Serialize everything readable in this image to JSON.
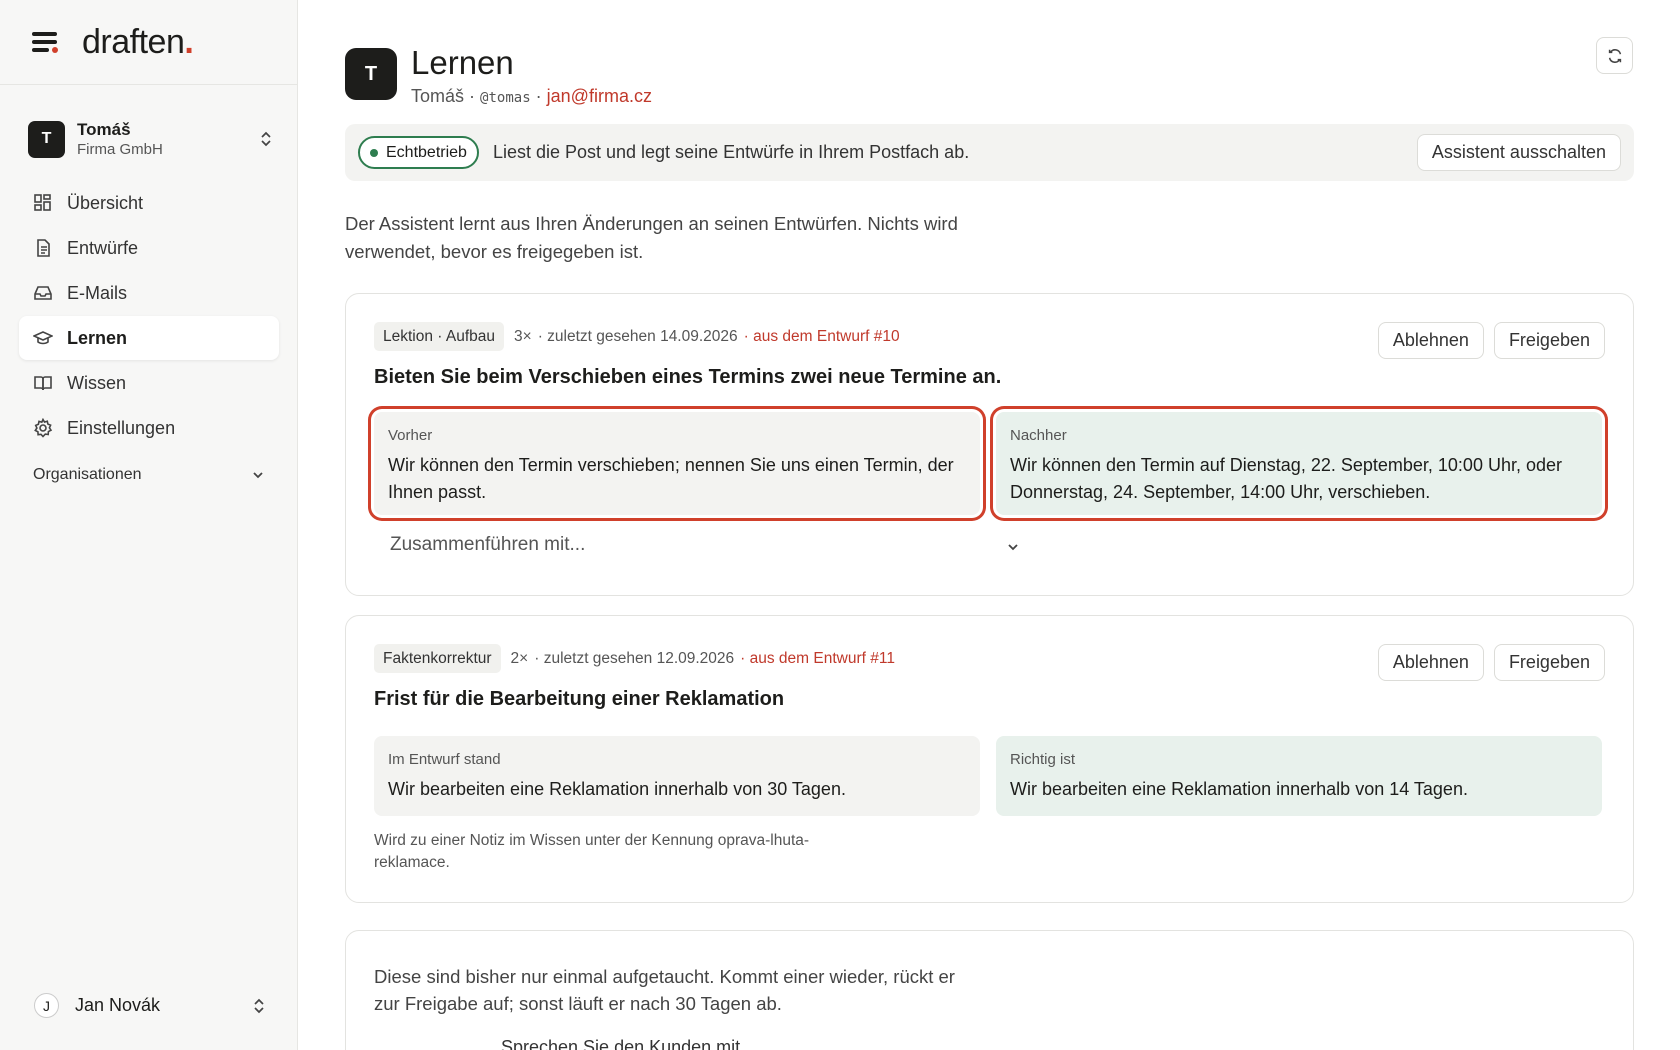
{
  "sidebar": {
    "logo": "draften",
    "logo_dot": ".",
    "org": {
      "avatar": "T",
      "name": "Tomáš",
      "company": "Firma GmbH"
    },
    "nav": [
      {
        "label": "Übersicht",
        "icon": "grid-icon"
      },
      {
        "label": "Entwürfe",
        "icon": "document-icon"
      },
      {
        "label": "E-Mails",
        "icon": "inbox-icon"
      },
      {
        "label": "Lernen",
        "icon": "graduation-cap-icon",
        "active": true
      },
      {
        "label": "Wissen",
        "icon": "book-icon"
      },
      {
        "label": "Einstellungen",
        "icon": "gear-icon"
      }
    ],
    "organisations_label": "Organisationen",
    "user": {
      "avatar": "J",
      "name": "Jan Novák"
    }
  },
  "header": {
    "avatar": "T",
    "title": "Lernen",
    "name": "Tomáš",
    "handle": "@tomas",
    "email": "jan@firma.cz",
    "sep": "·"
  },
  "banner": {
    "status": "Echtbetrieb",
    "text": "Liest die Post und legt seine Entwürfe in Ihrem Postfach ab.",
    "button": "Assistent ausschalten"
  },
  "intro": "Der Assistent lernt aus Ihren Änderungen an seinen Entwürfen. Nichts wird verwendet, bevor es freigegeben ist.",
  "lessons": [
    {
      "tag": "Lektion · Aufbau",
      "count": "3×",
      "last_seen": "· zuletzt gesehen 14.09.2026",
      "source": "· aus dem Entwurf #10",
      "reject": "Ablehnen",
      "approve": "Freigeben",
      "title": "Bieten Sie beim Verschieben eines Termins zwei neue Termine an.",
      "before_label": "Vorher",
      "before_text": "Wir können den Termin verschieben; nennen Sie uns einen Termin, der Ihnen passt.",
      "after_label": "Nachher",
      "after_text": "Wir können den Termin auf Dienstag, 22. September, 10:00 Uhr, oder Donnerstag, 24. September, 14:00 Uhr, verschieben.",
      "merge_placeholder": "Zusammenführen mit..."
    },
    {
      "tag": "Faktenkorrektur",
      "count": "2×",
      "last_seen": "· zuletzt gesehen 12.09.2026",
      "source": "· aus dem Entwurf #11",
      "reject": "Ablehnen",
      "approve": "Freigeben",
      "title": "Frist für die Bearbeitung einer Reklamation",
      "before_label": "Im Entwurf stand",
      "before_text": "Wir bearbeiten eine Reklamation innerhalb von 30 Tagen.",
      "after_label": "Richtig ist",
      "after_text": "Wir bearbeiten eine Reklamation innerhalb von 14 Tagen.",
      "note": "Wird zu einer Notiz im Wissen unter der Kennung oprava-lhuta-reklamace."
    }
  ],
  "pending": {
    "text": "Diese sind bisher nur einmal aufgetaucht. Kommt einer wieder, rückt er zur Freigabe auf; sonst läuft er nach 30 Tagen ab.",
    "partial_item": "Sprechen Sie den Kunden mit"
  },
  "colors": {
    "accent": "#d0402b",
    "live": "#2e7d4f",
    "after_bg": "#e8f1ec"
  }
}
